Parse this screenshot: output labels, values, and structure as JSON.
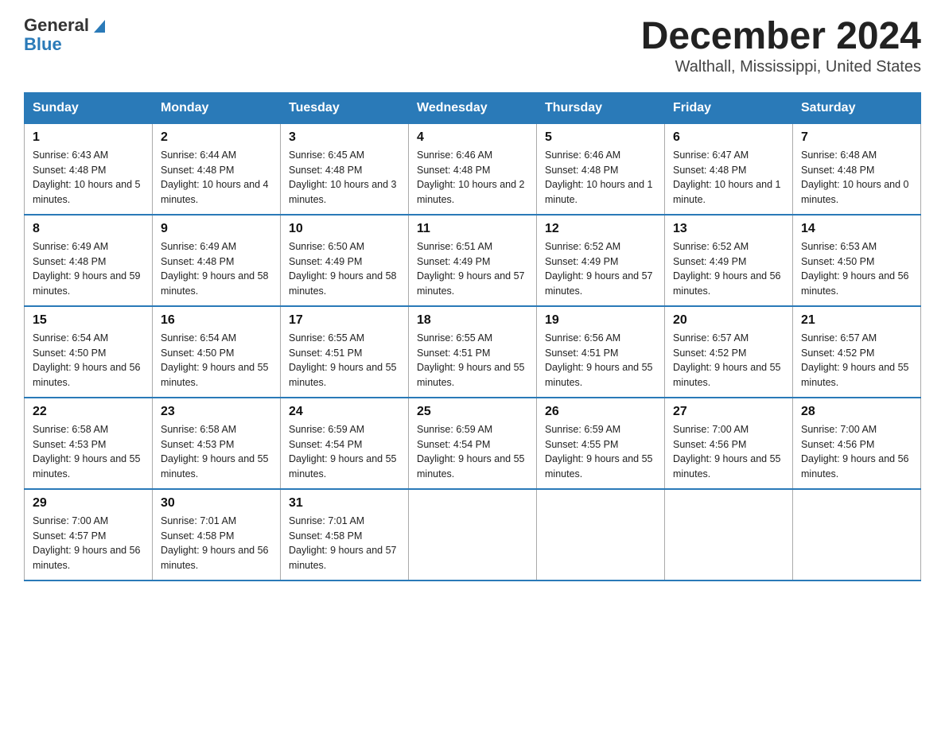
{
  "header": {
    "logo_general": "General",
    "logo_blue": "Blue",
    "month_title": "December 2024",
    "location": "Walthall, Mississippi, United States"
  },
  "days_of_week": [
    "Sunday",
    "Monday",
    "Tuesday",
    "Wednesday",
    "Thursday",
    "Friday",
    "Saturday"
  ],
  "weeks": [
    [
      {
        "day": "1",
        "sunrise": "6:43 AM",
        "sunset": "4:48 PM",
        "daylight": "10 hours and 5 minutes."
      },
      {
        "day": "2",
        "sunrise": "6:44 AM",
        "sunset": "4:48 PM",
        "daylight": "10 hours and 4 minutes."
      },
      {
        "day": "3",
        "sunrise": "6:45 AM",
        "sunset": "4:48 PM",
        "daylight": "10 hours and 3 minutes."
      },
      {
        "day": "4",
        "sunrise": "6:46 AM",
        "sunset": "4:48 PM",
        "daylight": "10 hours and 2 minutes."
      },
      {
        "day": "5",
        "sunrise": "6:46 AM",
        "sunset": "4:48 PM",
        "daylight": "10 hours and 1 minute."
      },
      {
        "day": "6",
        "sunrise": "6:47 AM",
        "sunset": "4:48 PM",
        "daylight": "10 hours and 1 minute."
      },
      {
        "day": "7",
        "sunrise": "6:48 AM",
        "sunset": "4:48 PM",
        "daylight": "10 hours and 0 minutes."
      }
    ],
    [
      {
        "day": "8",
        "sunrise": "6:49 AM",
        "sunset": "4:48 PM",
        "daylight": "9 hours and 59 minutes."
      },
      {
        "day": "9",
        "sunrise": "6:49 AM",
        "sunset": "4:48 PM",
        "daylight": "9 hours and 58 minutes."
      },
      {
        "day": "10",
        "sunrise": "6:50 AM",
        "sunset": "4:49 PM",
        "daylight": "9 hours and 58 minutes."
      },
      {
        "day": "11",
        "sunrise": "6:51 AM",
        "sunset": "4:49 PM",
        "daylight": "9 hours and 57 minutes."
      },
      {
        "day": "12",
        "sunrise": "6:52 AM",
        "sunset": "4:49 PM",
        "daylight": "9 hours and 57 minutes."
      },
      {
        "day": "13",
        "sunrise": "6:52 AM",
        "sunset": "4:49 PM",
        "daylight": "9 hours and 56 minutes."
      },
      {
        "day": "14",
        "sunrise": "6:53 AM",
        "sunset": "4:50 PM",
        "daylight": "9 hours and 56 minutes."
      }
    ],
    [
      {
        "day": "15",
        "sunrise": "6:54 AM",
        "sunset": "4:50 PM",
        "daylight": "9 hours and 56 minutes."
      },
      {
        "day": "16",
        "sunrise": "6:54 AM",
        "sunset": "4:50 PM",
        "daylight": "9 hours and 55 minutes."
      },
      {
        "day": "17",
        "sunrise": "6:55 AM",
        "sunset": "4:51 PM",
        "daylight": "9 hours and 55 minutes."
      },
      {
        "day": "18",
        "sunrise": "6:55 AM",
        "sunset": "4:51 PM",
        "daylight": "9 hours and 55 minutes."
      },
      {
        "day": "19",
        "sunrise": "6:56 AM",
        "sunset": "4:51 PM",
        "daylight": "9 hours and 55 minutes."
      },
      {
        "day": "20",
        "sunrise": "6:57 AM",
        "sunset": "4:52 PM",
        "daylight": "9 hours and 55 minutes."
      },
      {
        "day": "21",
        "sunrise": "6:57 AM",
        "sunset": "4:52 PM",
        "daylight": "9 hours and 55 minutes."
      }
    ],
    [
      {
        "day": "22",
        "sunrise": "6:58 AM",
        "sunset": "4:53 PM",
        "daylight": "9 hours and 55 minutes."
      },
      {
        "day": "23",
        "sunrise": "6:58 AM",
        "sunset": "4:53 PM",
        "daylight": "9 hours and 55 minutes."
      },
      {
        "day": "24",
        "sunrise": "6:59 AM",
        "sunset": "4:54 PM",
        "daylight": "9 hours and 55 minutes."
      },
      {
        "day": "25",
        "sunrise": "6:59 AM",
        "sunset": "4:54 PM",
        "daylight": "9 hours and 55 minutes."
      },
      {
        "day": "26",
        "sunrise": "6:59 AM",
        "sunset": "4:55 PM",
        "daylight": "9 hours and 55 minutes."
      },
      {
        "day": "27",
        "sunrise": "7:00 AM",
        "sunset": "4:56 PM",
        "daylight": "9 hours and 55 minutes."
      },
      {
        "day": "28",
        "sunrise": "7:00 AM",
        "sunset": "4:56 PM",
        "daylight": "9 hours and 56 minutes."
      }
    ],
    [
      {
        "day": "29",
        "sunrise": "7:00 AM",
        "sunset": "4:57 PM",
        "daylight": "9 hours and 56 minutes."
      },
      {
        "day": "30",
        "sunrise": "7:01 AM",
        "sunset": "4:58 PM",
        "daylight": "9 hours and 56 minutes."
      },
      {
        "day": "31",
        "sunrise": "7:01 AM",
        "sunset": "4:58 PM",
        "daylight": "9 hours and 57 minutes."
      },
      null,
      null,
      null,
      null
    ]
  ],
  "labels": {
    "sunrise": "Sunrise:",
    "sunset": "Sunset:",
    "daylight": "Daylight:"
  }
}
